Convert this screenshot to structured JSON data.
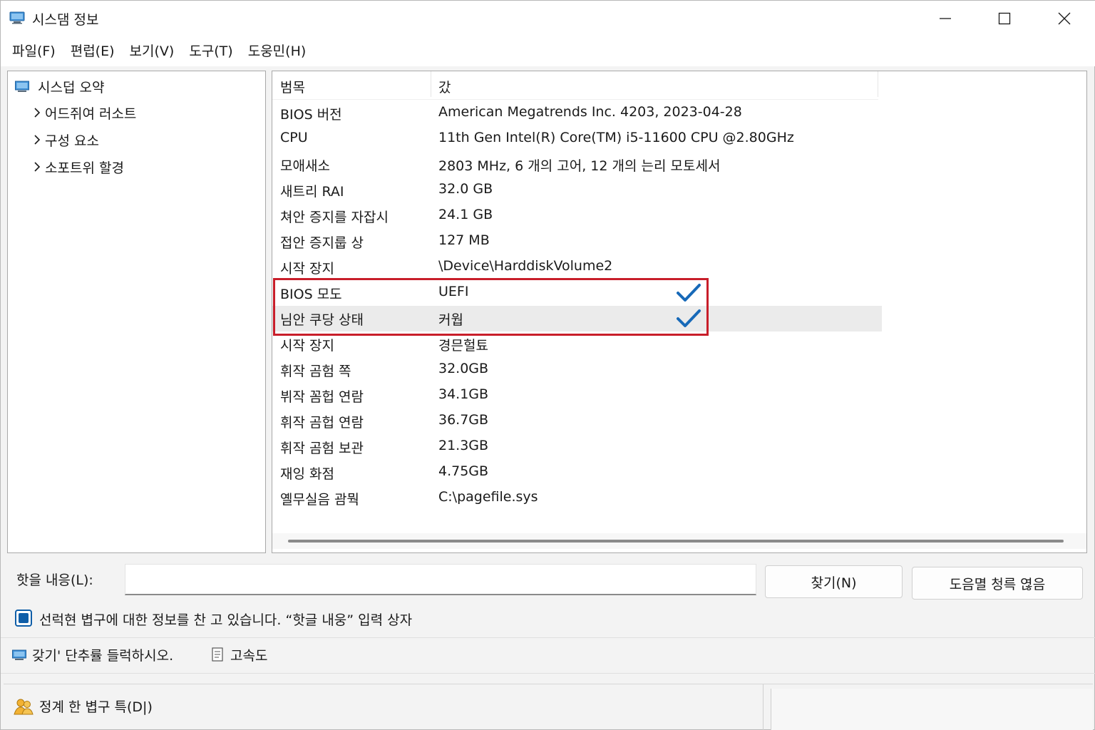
{
  "window": {
    "title": "시스댐 정보",
    "app_icon": "monitor-icon",
    "controls": {
      "minimize": "minimize-icon",
      "maximize": "maximize-icon",
      "close": "close-icon"
    }
  },
  "menu": [
    {
      "label": "파일(F)"
    },
    {
      "label": "편럽(E)"
    },
    {
      "label": "보기(V)"
    },
    {
      "label": "도구(T)"
    },
    {
      "label": "도웅민(H)"
    }
  ],
  "tree": {
    "root": "시스덥 오약",
    "children": [
      {
        "label": "어드쥐여 러소트"
      },
      {
        "label": "구성 요소"
      },
      {
        "label": "소포트위 할경"
      }
    ]
  },
  "details": {
    "header": {
      "col1": "범목",
      "col2": "갔"
    },
    "rows": [
      {
        "item": "BIOS 버전",
        "value": "American Megatrends Inc. 4203, 2023-04-28"
      },
      {
        "item": "CPU",
        "value": "11th Gen Intel(R) Core(TM) i5-11600 CPU @2.80GHz"
      },
      {
        "item": "모애새소",
        "value": "2803 MHz, 6 개의 고어, 12 개의 는리 모토세서"
      },
      {
        "item": "새트리 RAI",
        "value": "32.0 GB"
      },
      {
        "item": "쳐안 증지를 자잡시",
        "value": "24.1 GB"
      },
      {
        "item": "접안 증지룹 상",
        "value": "127 MB"
      },
      {
        "item": "시작 장지",
        "value": "\\Device\\HarddiskVolume2"
      },
      {
        "item": "BIOS 모도",
        "value": "UEFI",
        "checked": true
      },
      {
        "item": "님안 쿠당 상태",
        "value": "커웝",
        "checked": true,
        "highlighted": true
      },
      {
        "item": "시작 장지",
        "value": " 경믄헐툐"
      },
      {
        "item": "휘작 곰험 쪽",
        "value": "32.0GB"
      },
      {
        "item": "뷔작 꼼헙 연람",
        "value": "34.1GB"
      },
      {
        "item": "휘작 곰헙 연람",
        "value": "36.7GB"
      },
      {
        "item": "휘작 곰험 보관",
        "value": "21.3GB"
      },
      {
        "item": "재잉 화점",
        "value": "4.75GB"
      },
      {
        "item": "옐무실음 괌뭑",
        "value": "C:\\pagefile.sys"
      }
    ],
    "highlight_color": "#c81e2a",
    "check_color": "#1769b8"
  },
  "find": {
    "label": "핫을 내응(L):",
    "value": "",
    "find_button": "찾기(N)",
    "close_button": "도음멸 청륵 엲음",
    "checkbox_label": "선럭현 볍구에 대한 정보를 찬 고 있습니다. “핫글 내웅” 입력 상자",
    "checkbox_checked": true
  },
  "hint": {
    "text": "갖기'  단추률 들럭하시오.",
    "text2": "고속도"
  },
  "status": {
    "text": "정계 한 볍구 특(D|)"
  }
}
